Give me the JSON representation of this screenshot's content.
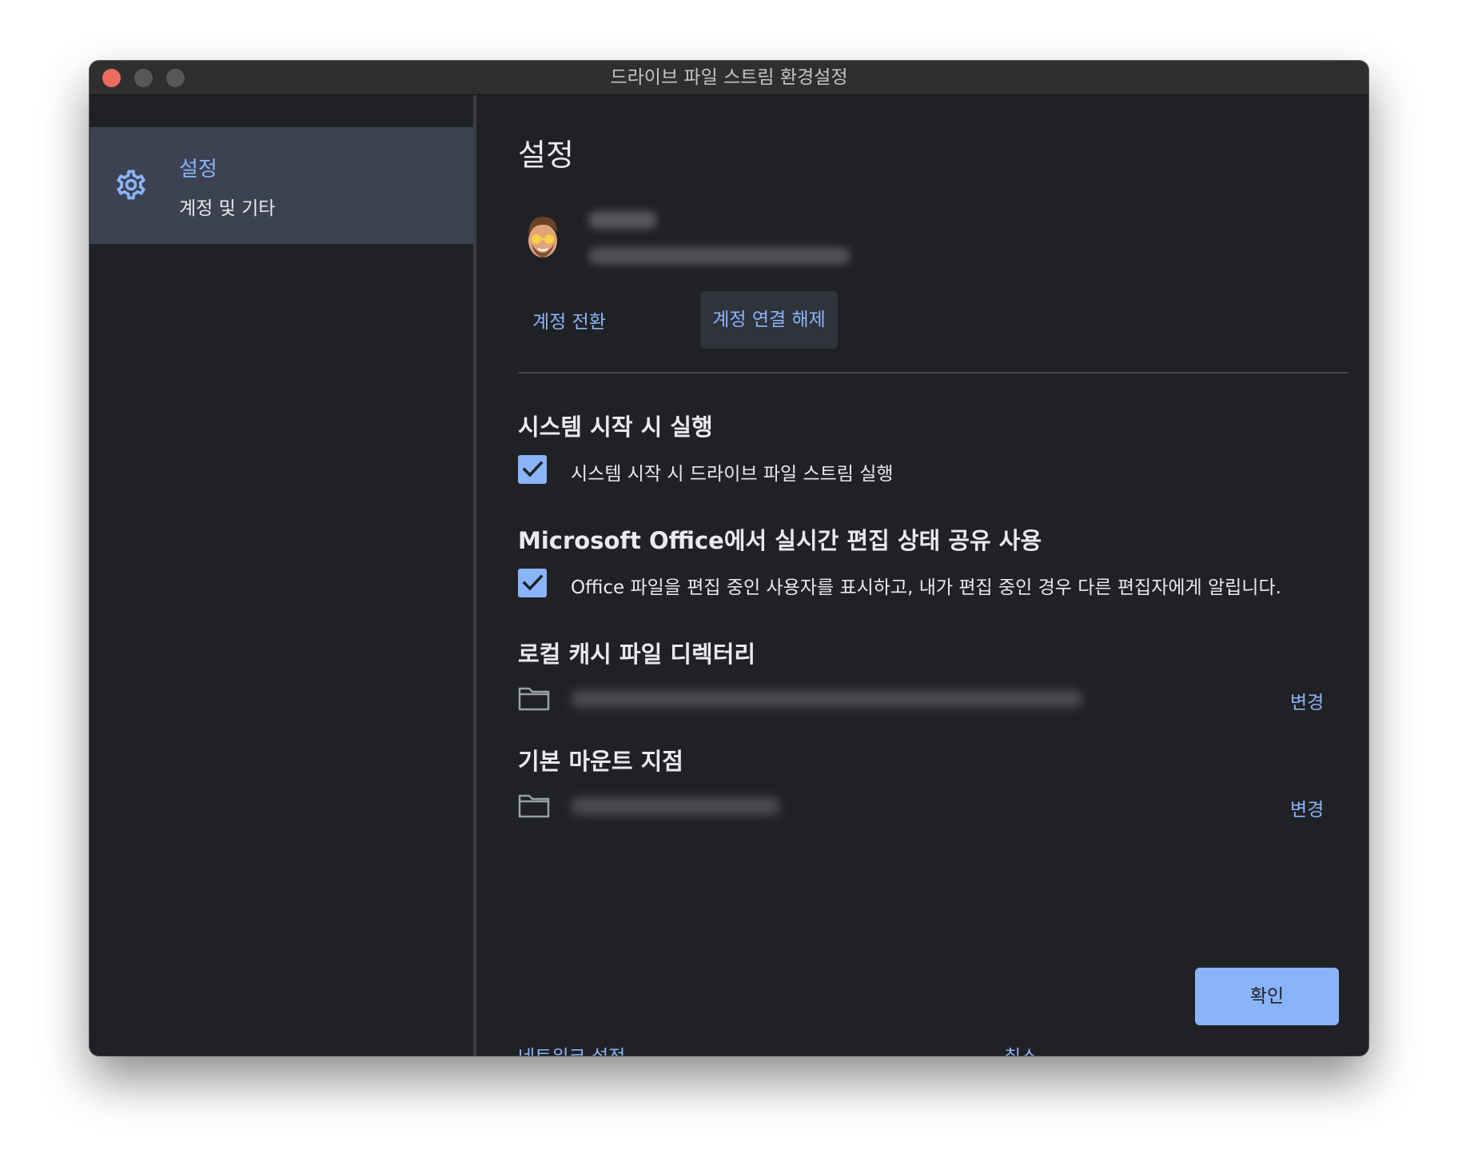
{
  "window": {
    "title": "드라이브 파일 스트림 환경설정"
  },
  "sidebar": {
    "items": [
      {
        "title": "설정",
        "subtitle": "계정 및 기타",
        "icon": "gear-icon"
      }
    ]
  },
  "main": {
    "page_title": "설정",
    "account": {
      "switch_label": "계정 전환",
      "disconnect_label": "계정 연결 해제"
    },
    "startup": {
      "title": "시스템 시작 시 실행",
      "checkbox_label": "시스템 시작 시 드라이브 파일 스트림 실행",
      "checked": true
    },
    "office": {
      "title": "Microsoft Office에서 실시간 편집 상태 공유 사용",
      "checkbox_label": "Office 파일을 편집 중인 사용자를 표시하고, 내가 편집 중인 경우 다른 편집자에게 알립니다.",
      "checked": true
    },
    "cache": {
      "title": "로컬 캐시 파일 디렉터리",
      "change_label": "변경"
    },
    "mount": {
      "title": "기본 마운트 지점",
      "change_label": "변경"
    },
    "footer": {
      "network_label": "네트워크 설정",
      "cancel_label": "취소",
      "ok_label": "확인"
    }
  },
  "colors": {
    "accent": "#8ab4f8",
    "background": "#202124",
    "sidebar_selected": "#3c4252",
    "text": "#e8eaed"
  }
}
